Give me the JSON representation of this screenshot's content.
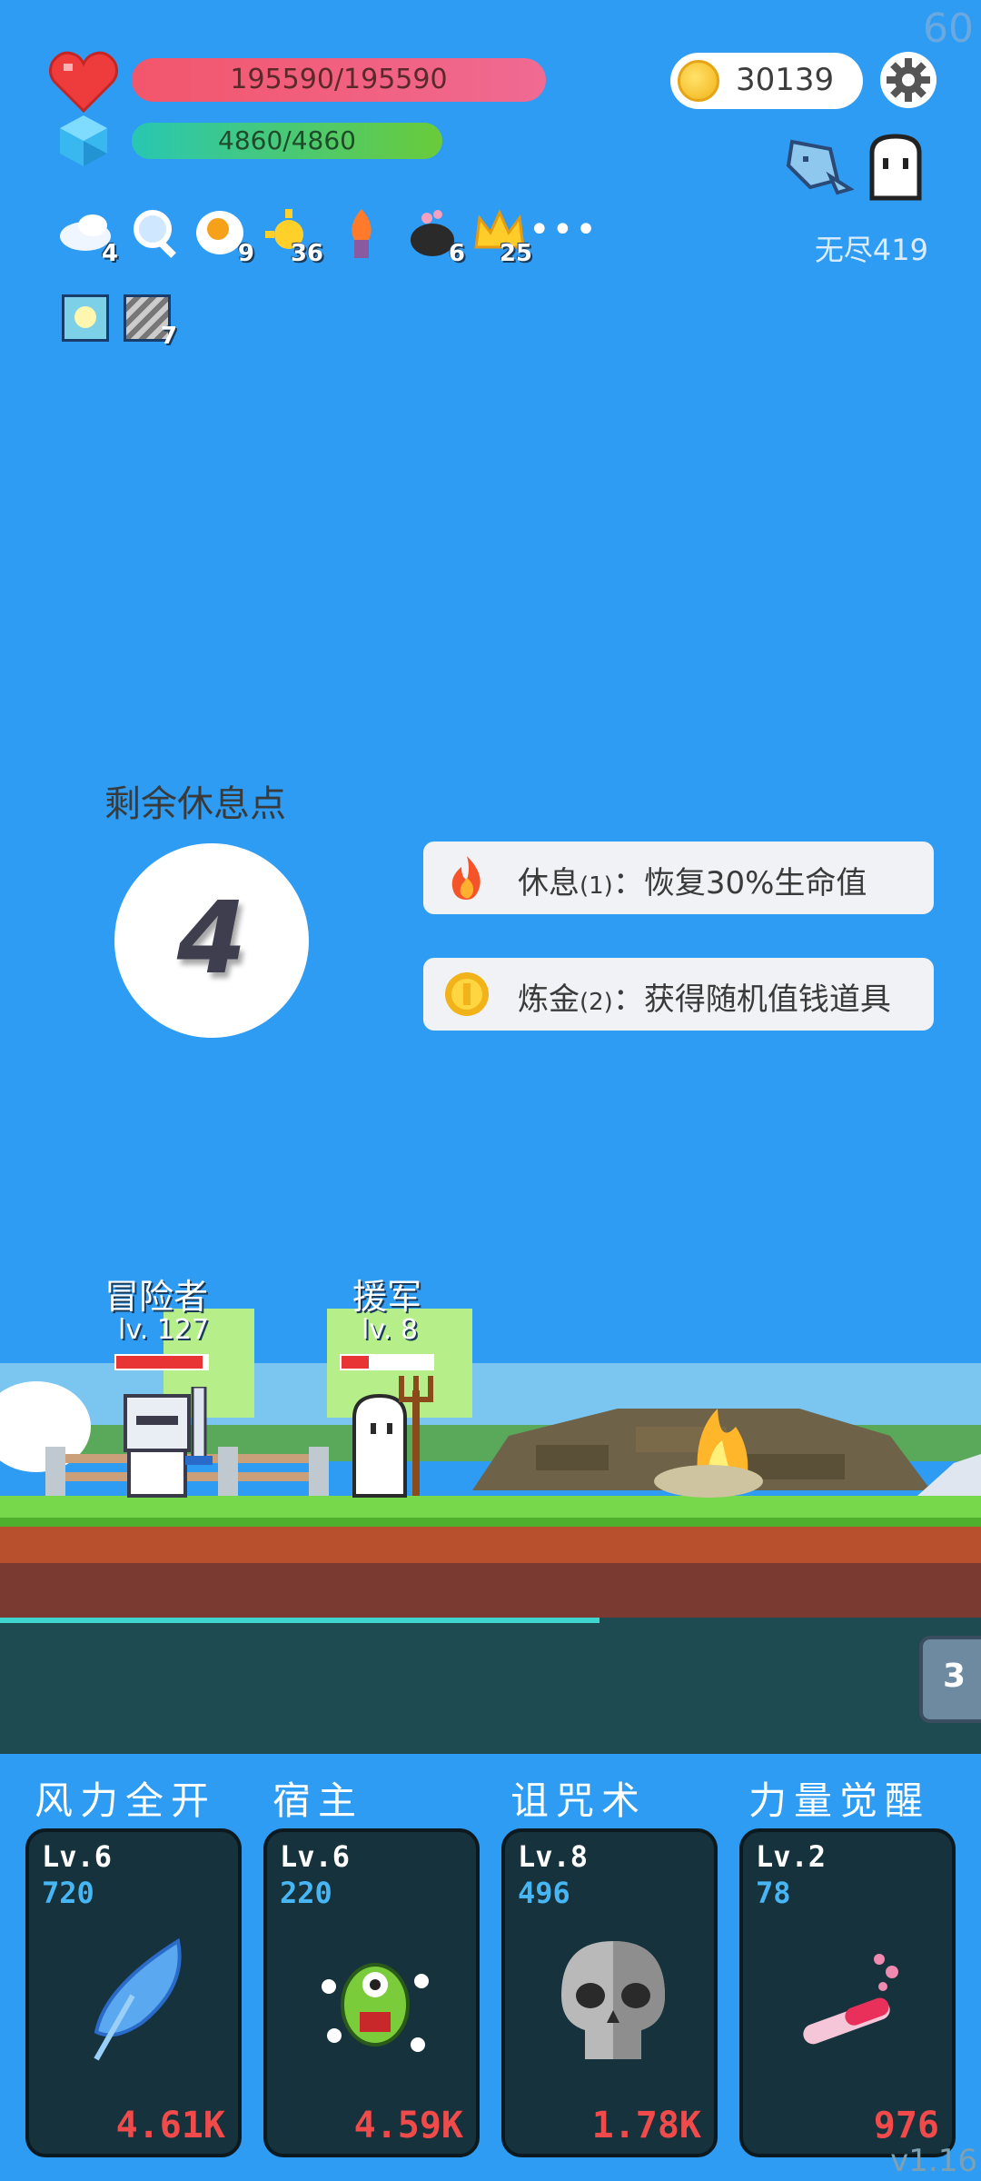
{
  "fps": "60",
  "stats": {
    "hp": "195590/195590",
    "mp": "4860/4860",
    "coins": "30139"
  },
  "mode": "无尽419",
  "items": [
    {
      "icon": "cloud-wing-icon",
      "count": "4"
    },
    {
      "icon": "magnifier-icon",
      "count": ""
    },
    {
      "icon": "fried-egg-icon",
      "count": "9"
    },
    {
      "icon": "sun-icon",
      "count": "36"
    },
    {
      "icon": "flame-torch-icon",
      "count": ""
    },
    {
      "icon": "cauldron-icon",
      "count": "6"
    },
    {
      "icon": "crown-icon",
      "count": "25"
    }
  ],
  "more": "•••",
  "buffs": [
    {
      "icon": "light-bulb-buff-icon",
      "count": ""
    },
    {
      "icon": "striped-scroll-buff-icon",
      "count": "7"
    }
  ],
  "rest": {
    "title": "剩余休息点",
    "points": "4",
    "options": [
      {
        "label": "休息",
        "count": "(1)",
        "desc": "：恢复30%生命值",
        "icon": "fire-icon"
      },
      {
        "label": "炼金",
        "count": "(2)",
        "desc": "：获得随机值钱道具",
        "icon": "coin-icon"
      }
    ]
  },
  "characters": [
    {
      "name": "冒险者",
      "level": "lv. 127",
      "hp_fraction": 0.95
    },
    {
      "name": "援军",
      "level": "lv. 8",
      "hp_fraction": 0.3
    }
  ],
  "tab_badge": "3",
  "skills": [
    {
      "name": "风力全开",
      "level": "Lv.6",
      "value": "720",
      "cost": "4.61K",
      "icon": "blue-feather-icon"
    },
    {
      "name": "宿主",
      "level": "Lv.6",
      "value": "220",
      "cost": "4.59K",
      "icon": "green-monster-icon"
    },
    {
      "name": "诅咒术",
      "level": "Lv.8",
      "value": "496",
      "cost": "1.78K",
      "icon": "skull-icon"
    },
    {
      "name": "力量觉醒",
      "level": "Lv.2",
      "value": "78",
      "cost": "976",
      "icon": "potion-tube-icon"
    }
  ],
  "version": "v1.16",
  "colors": {
    "sky": "#2e9cf2",
    "hp": "#f2566c",
    "mp": "#3fc78a",
    "card": "#16323c",
    "cost": "#f04a4a",
    "value": "#47b6f5"
  }
}
